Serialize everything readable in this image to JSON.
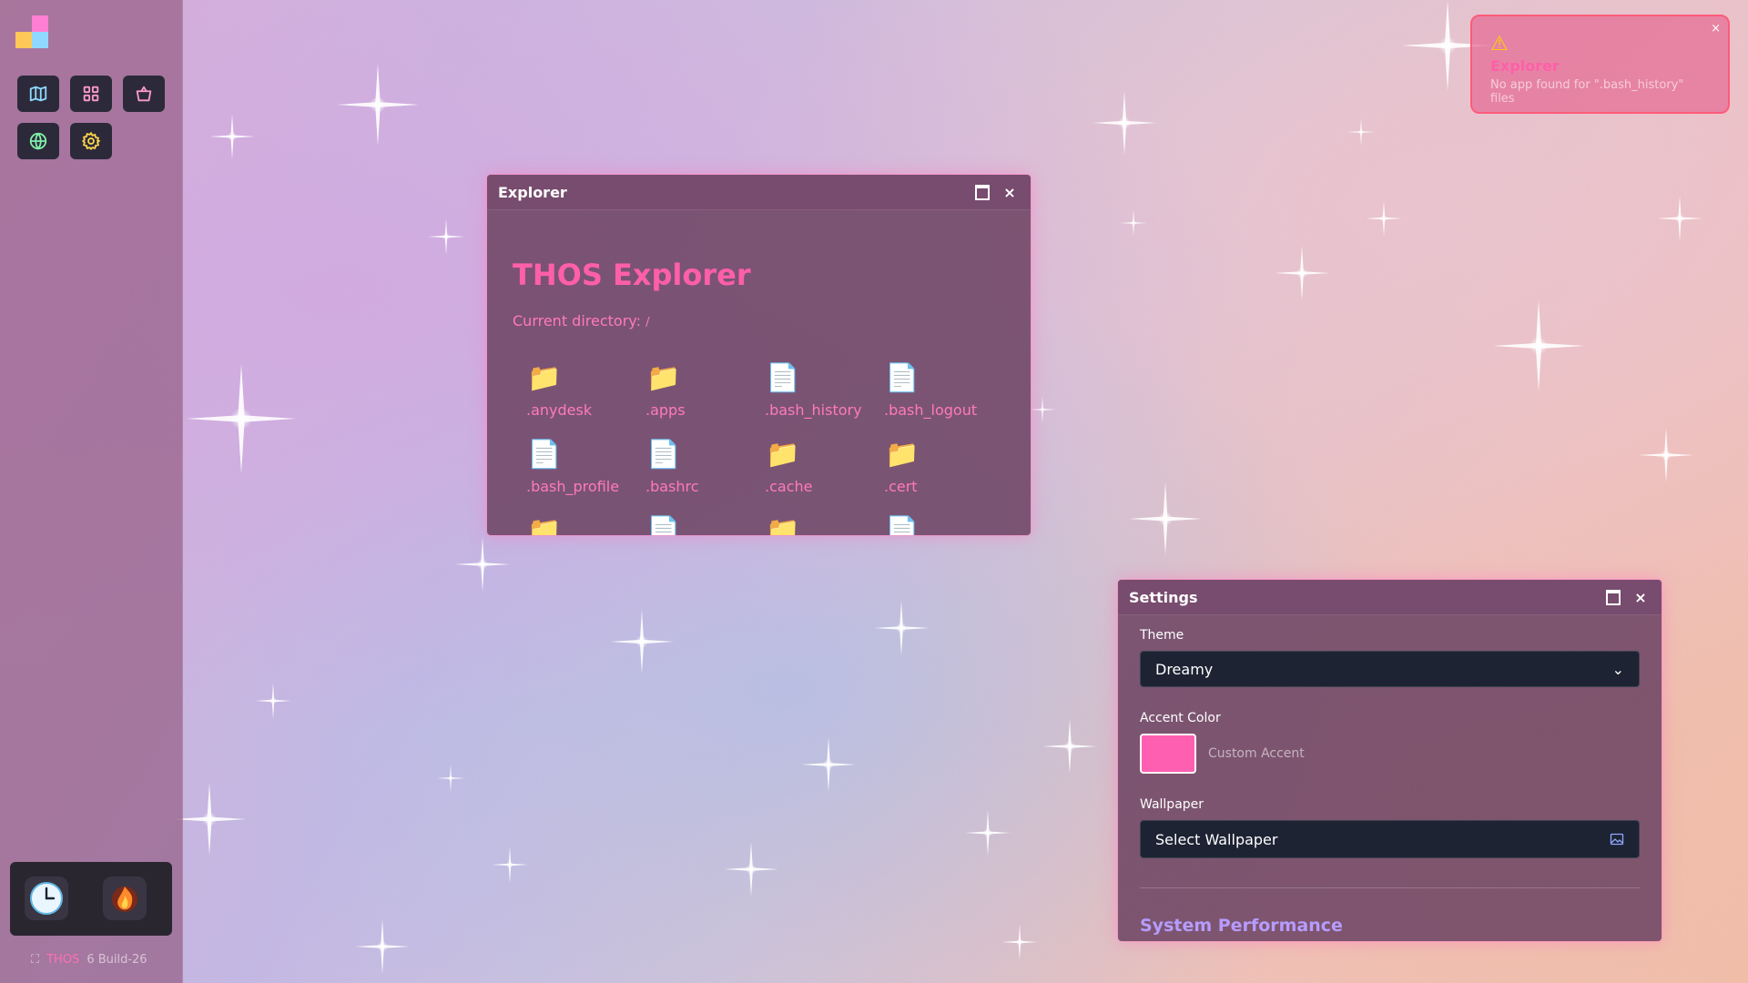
{
  "desktop": {
    "wallpaper_name": "sparkle-pastel",
    "colors": {
      "accent": "#ff5fb0",
      "sidebar": "#965f87",
      "window": "#6e4664"
    }
  },
  "sidebar": {
    "apps": [
      {
        "name": "map-icon",
        "color": "#8fd8ff"
      },
      {
        "name": "apps-grid-icon",
        "color": "#ff9acb"
      },
      {
        "name": "shopping-bag-icon",
        "color": "#ff9acb"
      },
      {
        "name": "globe-icon",
        "color": "#7ff0a8"
      },
      {
        "name": "gear-icon",
        "color": "#ffd54a"
      }
    ],
    "dock": [
      {
        "name": "clock-icon"
      },
      {
        "name": "app-fire-icon"
      }
    ],
    "version": {
      "brand": "THOS",
      "build": "6 Build-26"
    }
  },
  "explorer": {
    "window_title": "Explorer",
    "heading": "THOS Explorer",
    "dir_label": "Current directory:",
    "dir_path": "/",
    "files": [
      {
        "name": ".anydesk",
        "type": "folder"
      },
      {
        "name": ".apps",
        "type": "folder"
      },
      {
        "name": ".bash_history",
        "type": "file"
      },
      {
        "name": ".bash_logout",
        "type": "file"
      },
      {
        "name": ".bash_profile",
        "type": "file"
      },
      {
        "name": ".bashrc",
        "type": "file"
      },
      {
        "name": ".cache",
        "type": "folder"
      },
      {
        "name": ".cert",
        "type": "folder"
      },
      {
        "name": "",
        "type": "folder"
      },
      {
        "name": "",
        "type": "file"
      },
      {
        "name": "",
        "type": "folder"
      },
      {
        "name": "",
        "type": "file"
      }
    ]
  },
  "settings": {
    "window_title": "Settings",
    "theme_label": "Theme",
    "theme_value": "Dreamy",
    "accent_label": "Accent Color",
    "accent_name": "Custom Accent",
    "wallpaper_label": "Wallpaper",
    "wallpaper_value": "Select Wallpaper",
    "performance_title": "System Performance"
  },
  "toast": {
    "title": "Explorer",
    "message": "No app found for \".bash_history\" files",
    "icon": "warning-icon",
    "close_label": "×"
  }
}
